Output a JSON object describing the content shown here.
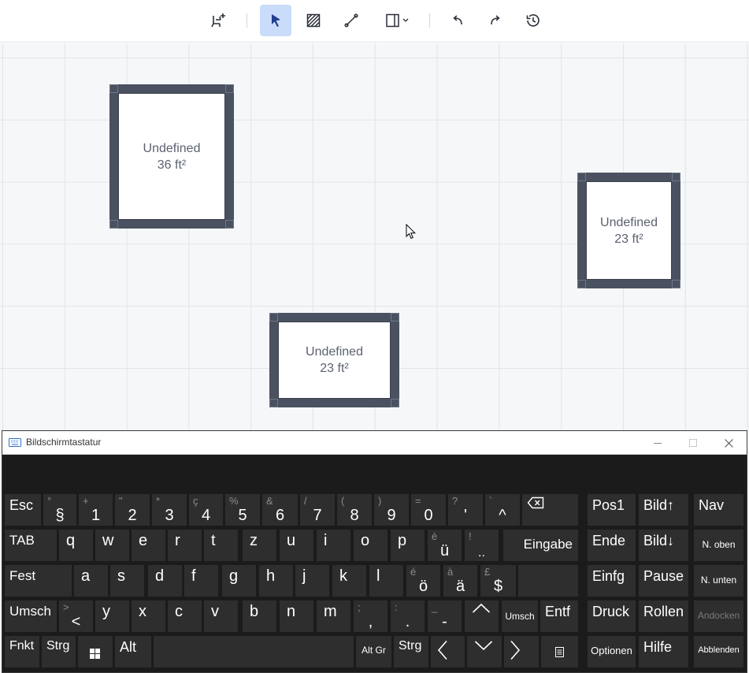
{
  "toolbar": {
    "icons": [
      "add-furniture-icon",
      "select-pointer-icon",
      "hatch-area-icon",
      "draw-line-icon",
      "panel-dropdown-icon",
      "undo-icon",
      "redo-icon",
      "history-icon"
    ],
    "active_tool": "select-pointer-icon",
    "accent": "#c9dcf9"
  },
  "rooms": [
    {
      "name": "Undefined",
      "area": "36 ft²"
    },
    {
      "name": "Undefined",
      "area": "23 ft²"
    },
    {
      "name": "Undefined",
      "area": "23 ft²"
    }
  ],
  "osk": {
    "title": "Bildschirmtastatur",
    "keys": {
      "esc": "Esc",
      "n1_up": "°",
      "n1_low": "§",
      "n2_up": "+",
      "n2_low": "1",
      "n3_up": "\"",
      "n3_low": "2",
      "n4_up": "*",
      "n4_low": "3",
      "n5_up": "ç",
      "n5_low": "4",
      "n6_up": "%",
      "n6_low": "5",
      "n7_up": "&",
      "n7_low": "6",
      "n8_up": "/",
      "n8_low": "7",
      "n9_up": "(",
      "n9_low": "8",
      "n10_up": ")",
      "n10_low": "9",
      "n11_up": "=",
      "n11_low": "0",
      "n12_up": "?",
      "n12_low": "'",
      "n13_up": "`",
      "n13_low": "^",
      "pos1": "Pos1",
      "bild_up": "Bild↑",
      "nav": "Nav",
      "tab": "TAB",
      "q": "q",
      "w": "w",
      "e": "e",
      "r": "r",
      "t": "t",
      "z": "z",
      "u": "u",
      "i": "i",
      "o": "o",
      "p": "p",
      "ue_up": "è",
      "ue_low": "ü",
      "excl_up": "!",
      "excl_low": "..",
      "eingabe": "Eingabe",
      "ende": "Ende",
      "bild_down": "Bild↓",
      "n_oben": "N. oben",
      "fest": "Fest",
      "a": "a",
      "s": "s",
      "d": "d",
      "f": "f",
      "g": "g",
      "h": "h",
      "j": "j",
      "k": "k",
      "l": "l",
      "oe_up": "é",
      "oe_low": "ö",
      "ae_up": "à",
      "ae_low": "ä",
      "dollar_up": "£",
      "dollar_low": "$",
      "einfg": "Einfg",
      "pause": "Pause",
      "n_unten": "N. unten",
      "umsch": "Umsch",
      "lt_up": ">",
      "lt_low": "<",
      "y": "y",
      "x": "x",
      "c": "c",
      "v": "v",
      "b": "b",
      "n": "n",
      "m": "m",
      "comma_up": ";",
      "comma_low": ",",
      "dot_up": ":",
      "dot_low": ".",
      "dash_up": "_",
      "dash_low": "-",
      "umsch_right": "Umsch",
      "entf": "Entf",
      "druck": "Druck",
      "rollen": "Rollen",
      "andocken": "Andocken",
      "fnkt": "Fnkt",
      "strg": "Strg",
      "alt": "Alt",
      "altgr": "Alt Gr",
      "strg_right": "Strg",
      "optionen": "Optionen",
      "hilfe": "Hilfe",
      "abblenden": "Abblenden"
    }
  }
}
